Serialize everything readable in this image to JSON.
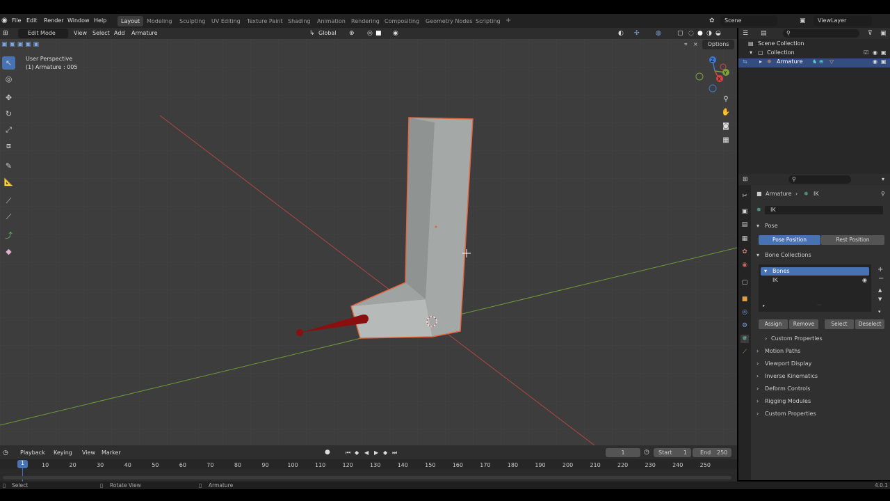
{
  "menu": [
    "File",
    "Edit",
    "Render",
    "Window",
    "Help"
  ],
  "workspaces": [
    "Layout",
    "Modeling",
    "Sculpting",
    "UV Editing",
    "Texture Paint",
    "Shading",
    "Animation",
    "Rendering",
    "Compositing",
    "Geometry Nodes",
    "Scripting"
  ],
  "add_tab": "+",
  "scene": "Scene",
  "view_layer": "ViewLayer",
  "viewport_header": {
    "mode": "Edit Mode",
    "view": "View",
    "select": "Select",
    "add": "Add",
    "armature": "Armature",
    "orientation": "Global",
    "options": "Options"
  },
  "viewport_info": {
    "perspective": "User Perspective",
    "object": "(1) Armature : 005"
  },
  "gizmo": {
    "x": "X",
    "y": "Y",
    "z": "Z"
  },
  "outliner": {
    "scene_collection": "Scene Collection",
    "collection": "Collection",
    "armature": "Armature"
  },
  "properties": {
    "breadcrumb_object": "Armature",
    "breadcrumb_data": "IK",
    "data_name": "IK",
    "pose_section": "Pose",
    "pose_position": "Pose Position",
    "rest_position": "Rest Position",
    "bone_collections": "Bone Collections",
    "collections": [
      "Bones",
      "IK"
    ],
    "assign": "Assign",
    "remove": "Remove",
    "select": "Select",
    "deselect": "Deselect",
    "custom_properties_sub": "Custom Properties",
    "panels": [
      "Motion Paths",
      "Viewport Display",
      "Inverse Kinematics",
      "Deform Controls",
      "Rigging Modules",
      "Custom Properties"
    ]
  },
  "timeline": {
    "playback": "Playback",
    "keying": "Keying",
    "view": "View",
    "marker": "Marker",
    "current_frame": "1",
    "start_label": "Start",
    "start": "1",
    "end_label": "End",
    "end": "250",
    "ticks": [
      "10",
      "20",
      "30",
      "40",
      "50",
      "60",
      "70",
      "80",
      "90",
      "100",
      "110",
      "120",
      "130",
      "140",
      "150",
      "160",
      "170",
      "180",
      "190",
      "200",
      "210",
      "220",
      "230",
      "240",
      "250"
    ],
    "playhead": "1"
  },
  "status": {
    "select": "Select",
    "rotate": "Rotate View",
    "armature": "Armature",
    "version": "4.0.1"
  },
  "colors": {
    "accent": "#4772b3",
    "selection_outline": "#e8643c",
    "bone": "#8b0f0f",
    "x_axis": "#c04040",
    "y_axis": "#7aa33a"
  }
}
